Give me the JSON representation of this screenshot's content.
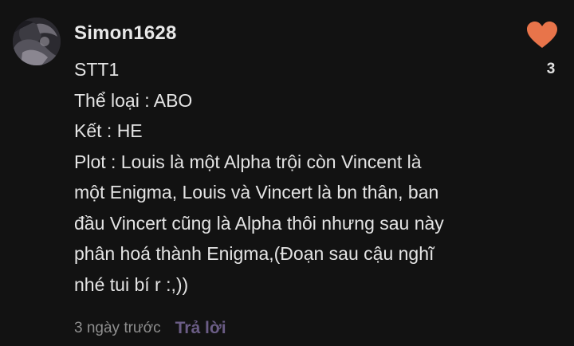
{
  "comment": {
    "username": "Simon1628",
    "lines": [
      "STT1",
      "Thể loại : ABO",
      "Kết : HE",
      "Plot : Louis là một Alpha trội còn Vincent là",
      "một Enigma, Louis và Vincert là bn thân, ban",
      "đầu Vincert cũng là Alpha thôi nhưng sau này",
      "phân hoá thành Enigma,(Đoạn sau cậu nghĩ",
      "nhé tui bí r :,))"
    ],
    "timestamp": "3 ngày trước",
    "reply_label": "Trả lời",
    "like_count": "3",
    "avatar_icon": "user-avatar",
    "like_icon": "heart-icon",
    "colors": {
      "background": "#121212",
      "heart": "#e8744a",
      "reply": "#6b5d86",
      "muted": "#8e8e8e"
    }
  }
}
